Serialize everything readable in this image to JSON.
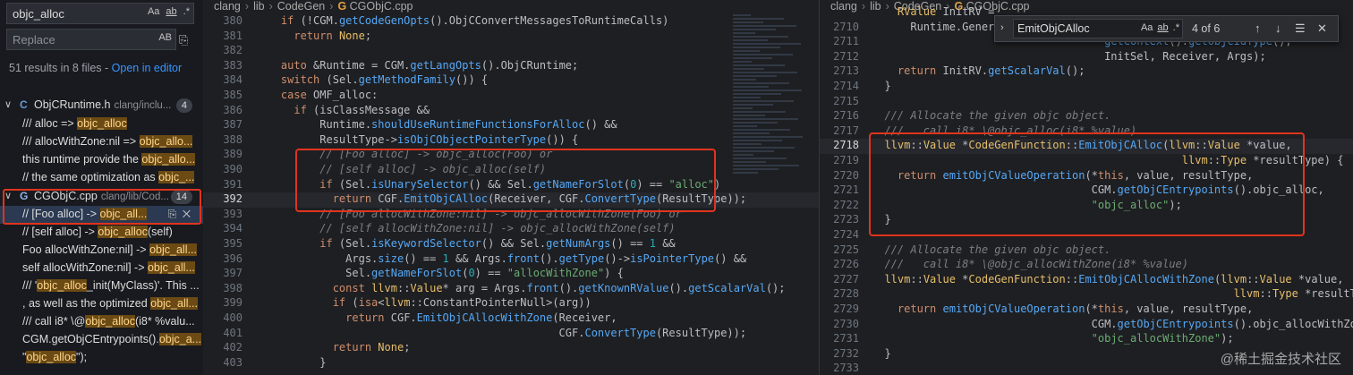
{
  "search": {
    "query": "objc_alloc",
    "toggles": [
      "Aa",
      "ab",
      ".*"
    ],
    "replace_placeholder": "Replace",
    "replace_toggle": "AB",
    "summary": "51 results in 8 files - ",
    "open_editor": "Open in editor"
  },
  "files": [
    {
      "name": "ObjCRuntime.h",
      "path": "clang/inclu...",
      "count": "4",
      "matches": [
        [
          "///  alloc => ",
          "objc_alloc",
          ""
        ],
        [
          "///  allocWithZone:nil => ",
          "objc_allo...",
          ""
        ],
        [
          "this runtime provide the ",
          "objc_allo...",
          ""
        ],
        [
          "// the same optimization as ",
          "objc_...",
          ""
        ]
      ]
    },
    {
      "name": "CGObjC.cpp",
      "path": "clang/lib/Cod...",
      "count": "14",
      "matches": [
        [
          "// [Foo alloc] -> ",
          "objc_all...",
          ""
        ],
        [
          "// [self alloc] -> ",
          "objc_alloc",
          "(self)"
        ],
        [
          "Foo allocWithZone:nil] -> ",
          "objc_all...",
          ""
        ],
        [
          "self allocWithZone:nil] -> ",
          "objc_all...",
          ""
        ],
        [
          "/// '",
          "objc_alloc",
          "_init(MyClass)'. This ..."
        ],
        [
          ", as well as the optimized ",
          "objc_all...",
          ""
        ],
        [
          "///   call i8* \\@",
          "objc_alloc",
          "(i8* %valu..."
        ],
        [
          "CGM.getObjCEntrypoints().",
          "objc_a...",
          ""
        ],
        [
          "\"",
          "objc_alloc",
          "\");"
        ]
      ]
    }
  ],
  "left_editor": {
    "breadcrumb": [
      "clang",
      "lib",
      "CodeGen",
      "CGObjC.cpp"
    ],
    "lines": [
      {
        "n": "380",
        "code": "    if (!CGM.getCodeGenOpts().ObjCConvertMessagesToRuntimeCalls)"
      },
      {
        "n": "381",
        "code": "      return None;"
      },
      {
        "n": "382",
        "code": ""
      },
      {
        "n": "383",
        "code": "    auto &Runtime = CGM.getLangOpts().ObjCRuntime;"
      },
      {
        "n": "384",
        "code": "    switch (Sel.getMethodFamily()) {"
      },
      {
        "n": "385",
        "code": "    case OMF_alloc:"
      },
      {
        "n": "386",
        "code": "      if (isClassMessage &&"
      },
      {
        "n": "387",
        "code": "          Runtime.shouldUseRuntimeFunctionsForAlloc() &&"
      },
      {
        "n": "388",
        "code": "          ResultType->isObjCObjectPointerType()) {"
      },
      {
        "n": "389",
        "code": "          // [Foo alloc] -> objc_alloc(Foo) or"
      },
      {
        "n": "390",
        "code": "          // [self alloc] -> objc_alloc(self)"
      },
      {
        "n": "391",
        "code": "          if (Sel.isUnarySelector() && Sel.getNameForSlot(0) == \"alloc\")"
      },
      {
        "n": "392",
        "code": "            return CGF.EmitObjCAlloc(Receiver, CGF.ConvertType(ResultType));"
      },
      {
        "n": "393",
        "code": "          // [Foo allocWithZone:nil] -> objc_allocWithZone(Foo) or"
      },
      {
        "n": "394",
        "code": "          // [self allocWithZone:nil] -> objc_allocWithZone(self)"
      },
      {
        "n": "395",
        "code": "          if (Sel.isKeywordSelector() && Sel.getNumArgs() == 1 &&"
      },
      {
        "n": "396",
        "code": "              Args.size() == 1 && Args.front().getType()->isPointerType() &&"
      },
      {
        "n": "397",
        "code": "              Sel.getNameForSlot(0) == \"allocWithZone\") {"
      },
      {
        "n": "398",
        "code": "            const llvm::Value* arg = Args.front().getKnownRValue().getScalarVal();"
      },
      {
        "n": "399",
        "code": "            if (isa<llvm::ConstantPointerNull>(arg))"
      },
      {
        "n": "400",
        "code": "              return CGF.EmitObjCAllocWithZone(Receiver,"
      },
      {
        "n": "401",
        "code": "                                               CGF.ConvertType(ResultType));"
      },
      {
        "n": "402",
        "code": "            return None;"
      },
      {
        "n": "403",
        "code": "          }"
      }
    ]
  },
  "right_editor": {
    "breadcrumb": [
      "clang",
      "lib",
      "CodeGen",
      "CGObjC.cpp"
    ],
    "find": {
      "query": "EmitObjCAlloc",
      "toggles": [
        "Aa",
        "ab",
        ".*"
      ],
      "count": "4 of 6"
    },
    "lines": [
      {
        "n": "",
        "code": "    RValue InitRV ="
      },
      {
        "n": "2710",
        "code": "      Runtime.Genera"
      },
      {
        "n": "2711",
        "code": "                                    getContext().getObjCIdType(),"
      },
      {
        "n": "2712",
        "code": "                                    InitSel, Receiver, Args);"
      },
      {
        "n": "2713",
        "code": "    return InitRV.getScalarVal();"
      },
      {
        "n": "2714",
        "code": "  }"
      },
      {
        "n": "2715",
        "code": ""
      },
      {
        "n": "2716",
        "code": "  /// Allocate the given objc object."
      },
      {
        "n": "2717",
        "code": "  ///   call i8* \\@objc_alloc(i8* %value)"
      },
      {
        "n": "2718",
        "code": "  llvm::Value *CodeGenFunction::EmitObjCAlloc(llvm::Value *value,"
      },
      {
        "n": "2719",
        "code": "                                                llvm::Type *resultType) {"
      },
      {
        "n": "2720",
        "code": "    return emitObjCValueOperation(*this, value, resultType,"
      },
      {
        "n": "2721",
        "code": "                                  CGM.getObjCEntrypoints().objc_alloc,"
      },
      {
        "n": "2722",
        "code": "                                  \"objc_alloc\");"
      },
      {
        "n": "2723",
        "code": "  }"
      },
      {
        "n": "2724",
        "code": ""
      },
      {
        "n": "2725",
        "code": "  /// Allocate the given objc object."
      },
      {
        "n": "2726",
        "code": "  ///   call i8* \\@objc_allocWithZone(i8* %value)"
      },
      {
        "n": "2727",
        "code": "  llvm::Value *CodeGenFunction::EmitObjCAllocWithZone(llvm::Value *value,"
      },
      {
        "n": "2728",
        "code": "                                                        llvm::Type *resultType) {"
      },
      {
        "n": "2729",
        "code": "    return emitObjCValueOperation(*this, value, resultType,"
      },
      {
        "n": "2730",
        "code": "                                  CGM.getObjCEntrypoints().objc_allocWithZone,"
      },
      {
        "n": "2731",
        "code": "                                  \"objc_allocWithZone\");"
      },
      {
        "n": "2732",
        "code": "  }"
      },
      {
        "n": "2733",
        "code": ""
      }
    ]
  },
  "watermark": "@稀土掘金技术社区",
  "colors": {
    "highlight_box": "#e0341e",
    "match_bg": "#6b4a14",
    "link": "#3794ff"
  }
}
